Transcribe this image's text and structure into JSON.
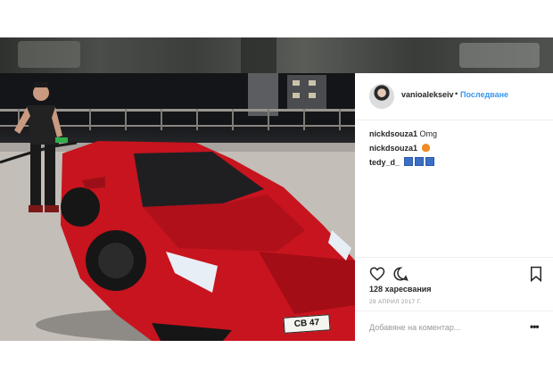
{
  "post": {
    "username": "vanioalekseiv",
    "separator": "•",
    "follow_label": "Последване",
    "comments": [
      {
        "user": "nickdsouza1",
        "text": "Omg"
      },
      {
        "user": "nickdsouza1",
        "text": ""
      },
      {
        "user": "tedy_d_",
        "text": ""
      }
    ],
    "likes_text": "128 харесвания",
    "date_text": "29 АПРИЛ 2017 Г.",
    "comment_placeholder": "Добавяне на коментар...",
    "more_label": "•••",
    "plate_text": "CB 47"
  },
  "icons": {
    "like": "heart-icon",
    "comment": "comment-icon",
    "save": "bookmark-icon",
    "more": "more-options-icon"
  },
  "colors": {
    "accent": "#3897f0",
    "car": "#c8141e",
    "text": "#262626"
  }
}
